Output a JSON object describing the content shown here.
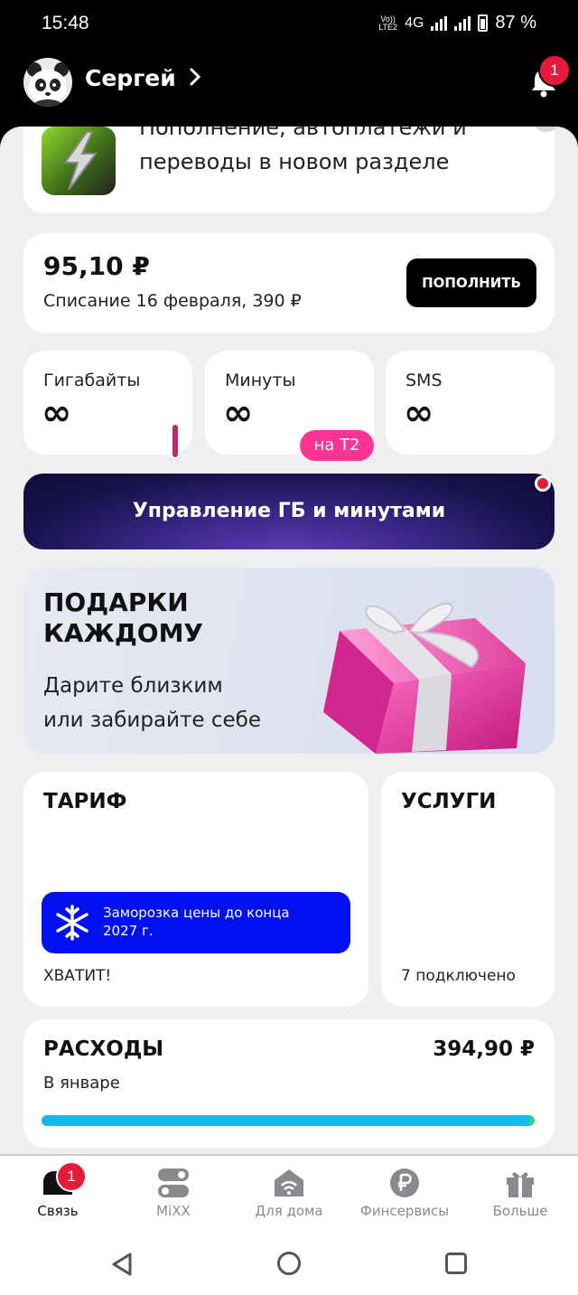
{
  "status_bar": {
    "time": "15:48",
    "volte": "Vo))",
    "lte": "LTE2",
    "network": "4G",
    "battery": "87 %"
  },
  "header": {
    "user_name": "Сергей",
    "notifications_count": "1"
  },
  "promo": {
    "text_line1": "Пополнение, автоплатежи и",
    "text_line2": "переводы в новом разделе",
    "close": "×"
  },
  "balance": {
    "amount": "95,10 ₽",
    "charge": "Списание 16 февраля, 390 ₽",
    "topup_label": "ПОПОЛНИТЬ"
  },
  "quotas": [
    {
      "label": "Гигабайты",
      "value": "∞"
    },
    {
      "label": "Минуты",
      "value": "∞"
    },
    {
      "label": "SMS",
      "value": "∞"
    }
  ],
  "t2_tag": "на Т2",
  "manage_button": "Управление ГБ и минутами",
  "gifts": {
    "title_line1": "ПОДАРКИ",
    "title_line2": "КАЖДОМУ",
    "desc_line1": "Дарите близким",
    "desc_line2": "или забирайте себе"
  },
  "tariff": {
    "title": "ТАРИФ",
    "freeze_line1": "Заморозка цены до конца",
    "freeze_line2": "2027 г.",
    "name": "ХВАТИТ!"
  },
  "services": {
    "title": "УСЛУГИ",
    "connected": "7 подключено"
  },
  "costs": {
    "title": "РАСХОДЫ",
    "amount": "394,90 ₽",
    "period": "В январе",
    "progress": 0.99
  },
  "nav": {
    "items": [
      {
        "label": "Связь",
        "badge": "1"
      },
      {
        "label": "MiXX"
      },
      {
        "label": "Для дома"
      },
      {
        "label": "Финсервисы"
      },
      {
        "label": "Больше"
      }
    ]
  },
  "colors": {
    "brand_blue": "#0010f0",
    "badge_red": "#e41c3a",
    "pink": "#ff3495",
    "progress": "#16b8ee"
  }
}
